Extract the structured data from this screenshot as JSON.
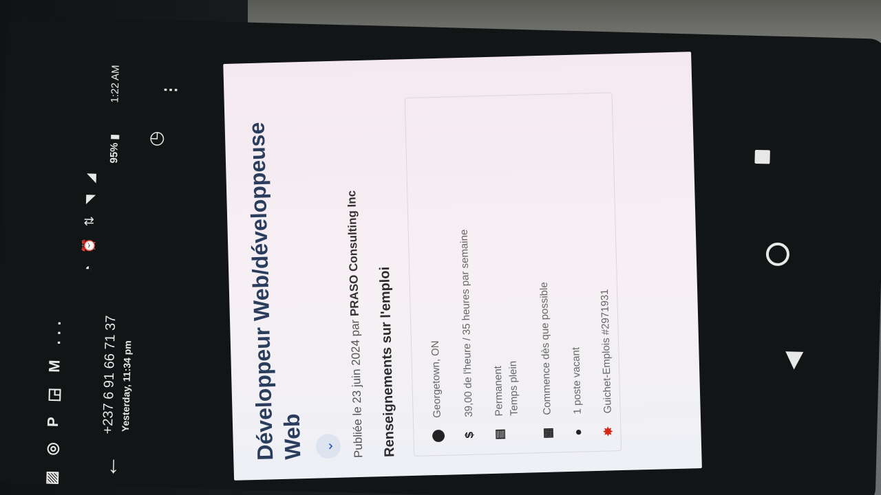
{
  "status_bar": {
    "time": "1:22 AM",
    "battery": "95%"
  },
  "header": {
    "contact_number": "+237 6 91 66 71 37",
    "contact_time": "Yesterday, 11:34 pm",
    "more_indicator": "..."
  },
  "job": {
    "title": "Développeur Web/développeuse Web",
    "posted_prefix": "Publiée le 23 juin 2024 par ",
    "employer": "PRASO Consulting Inc",
    "section_title": "Renseignements sur l'emploi",
    "details": [
      {
        "icon": "location-pin-icon",
        "glyph": "⬤",
        "lines": [
          "Georgetown, ON"
        ]
      },
      {
        "icon": "dollar-icon",
        "glyph": "$",
        "lines": [
          "39,00 de l'heure / 35 heures par semaine"
        ]
      },
      {
        "icon": "document-icon",
        "glyph": "▤",
        "lines": [
          "Permanent",
          "Temps plein"
        ]
      },
      {
        "icon": "calendar-icon",
        "glyph": "▦",
        "lines": [
          "Commence dès que possible"
        ]
      },
      {
        "icon": "person-icon",
        "glyph": "●",
        "lines": [
          "1 poste vacant"
        ]
      },
      {
        "icon": "maple-leaf-icon",
        "glyph": "✸",
        "lines": [
          "Guichet-Emplois #2971931"
        ]
      }
    ]
  },
  "colors": {
    "title": "#2a3d5c",
    "maple_leaf": "#d62718",
    "card_bg": "#f6f0f4"
  }
}
